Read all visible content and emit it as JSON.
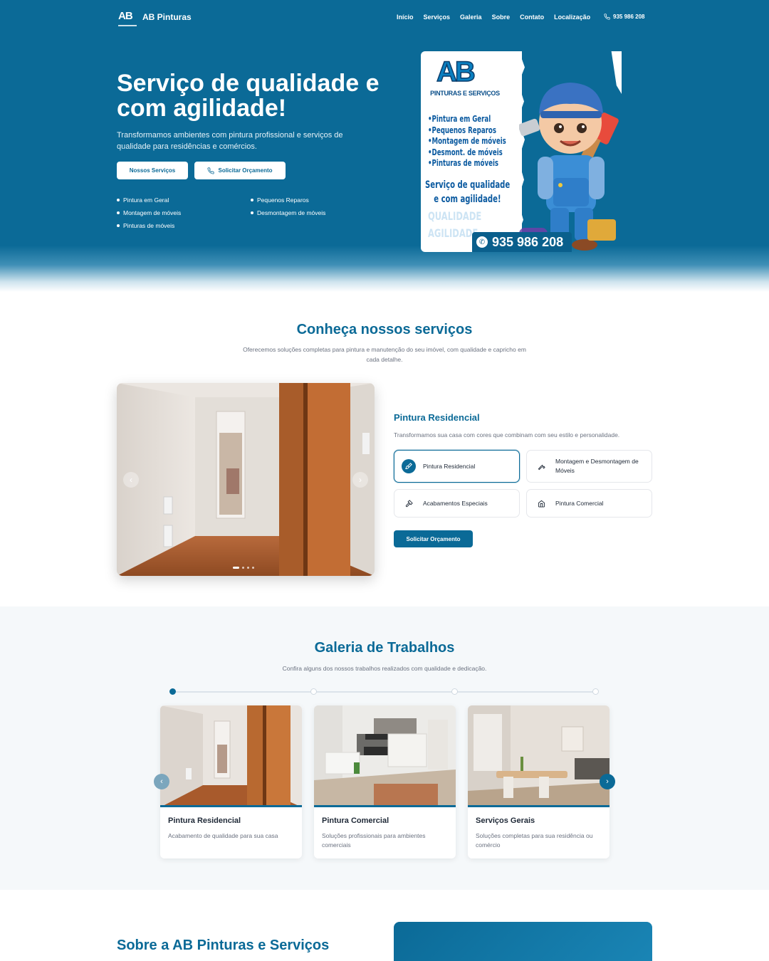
{
  "nav": {
    "brand": "AB Pinturas",
    "logo_text": "AB",
    "links": [
      "Início",
      "Serviços",
      "Galeria",
      "Sobre",
      "Contato",
      "Localização"
    ],
    "phone": "935 986 208"
  },
  "hero": {
    "title": "Serviço de qualidade e com agilidade!",
    "subtitle": "Transformamos ambientes com pintura profissional e serviços de qualidade para residências e comércios.",
    "btn_services": "Nossos Serviços",
    "btn_quote": "Solicitar Orçamento",
    "features": [
      "Pintura em Geral",
      "Montagem de móveis",
      "Pinturas de móveis",
      "Pequenos Reparos",
      "Desmontagem de móveis"
    ],
    "poster": {
      "logo": "AB",
      "logo_sub": "PINTURAS E SERVIÇOS",
      "list": [
        "•Pintura em Geral",
        "•Pequenos Reparos",
        "•Montagem de móveis",
        "•Desmont. de móveis",
        "•Pinturas de móveis"
      ],
      "tagline_1": "Serviço de qualidade",
      "tagline_2": "e com agilidade!",
      "ghost_1": "QUALIDADE",
      "ghost_2": "AGILIDADE",
      "phone": "935 986 208"
    }
  },
  "services": {
    "title": "Conheça nossos serviços",
    "subtitle": "Oferecemos soluções completas para pintura e manutenção do seu imóvel, com qualidade e capricho em cada detalhe.",
    "active_title": "Pintura Residencial",
    "active_desc": "Transformamos sua casa com cores que combinam com seu estilo e personalidade.",
    "cards": [
      "Pintura Residencial",
      "Montagem e Desmontagem de Móveis",
      "Acabamentos Especiais",
      "Pintura Comercial"
    ],
    "cta": "Solicitar Orçamento"
  },
  "gallery": {
    "title": "Galeria de Trabalhos",
    "subtitle": "Confira alguns dos nossos trabalhos realizados com qualidade e dedicação.",
    "items": [
      {
        "title": "Pintura Residencial",
        "desc": "Acabamento de qualidade para sua casa"
      },
      {
        "title": "Pintura Comercial",
        "desc": "Soluções profissionais para ambientes comerciais"
      },
      {
        "title": "Serviços Gerais",
        "desc": "Soluções completas para sua residência ou comércio"
      }
    ]
  },
  "about": {
    "title": "Sobre a AB Pinturas e Serviços"
  },
  "colors": {
    "primary": "#0b6a97",
    "text": "#1f2937",
    "muted": "#6b7280"
  }
}
